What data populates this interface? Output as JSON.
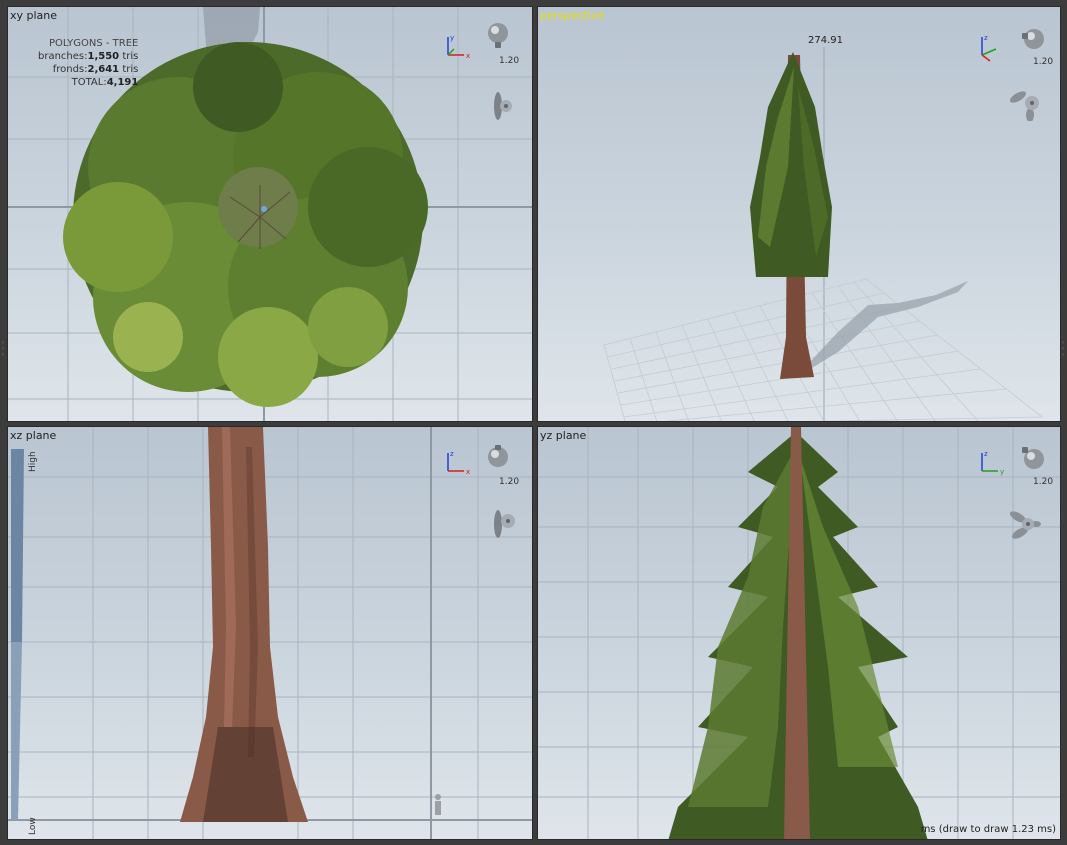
{
  "viewports": {
    "xy": {
      "title": "xy plane",
      "light_value": "1.20"
    },
    "perspective": {
      "title": "perspective",
      "light_value": "1.20",
      "height_label": "274.91"
    },
    "xz": {
      "title": "xz plane",
      "light_value": "1.20",
      "lod_high": "High",
      "lod_low": "Low"
    },
    "yz": {
      "title": "yz plane",
      "light_value": "1.20",
      "status_text": "ms (draw to draw 1.23 ms)"
    }
  },
  "stats": {
    "title": "POLYGONS - TREE",
    "branches_label": "branches:",
    "branches_value": "1,550",
    "branches_unit": " tris",
    "fronds_label": "fronds:",
    "fronds_value": "2,641",
    "fronds_unit": " tris",
    "total_label": "TOTAL:",
    "total_value": "4,191"
  },
  "colors": {
    "active_title": "#e8e000",
    "axis_x": "#d02020",
    "axis_y": "#20a020",
    "axis_z": "#2040d0",
    "foliage_dark": "#3f5a22",
    "foliage_light": "#7a9a3a",
    "bark": "#8a5a48"
  },
  "icons": [
    "axis-gizmo-icon",
    "light-bulb-icon",
    "propeller-icon",
    "grip-icon"
  ]
}
